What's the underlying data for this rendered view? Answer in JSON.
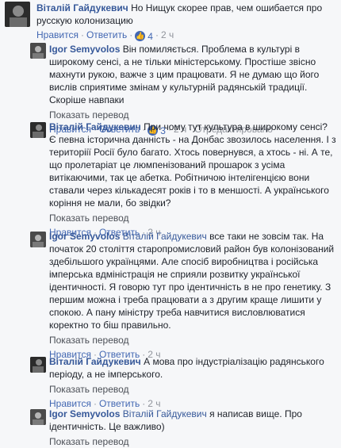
{
  "labels": {
    "like": "Нравится",
    "reply": "Ответить",
    "translate": "Показать перевод",
    "edited": "Отредактировано"
  },
  "comments": [
    {
      "author": "Віталій Гайдукевич",
      "mention": "",
      "text": "Но Нищук скорее прав, чем ошибается про русскую колонизацию",
      "likes": "4",
      "time": "2 ч",
      "edited": ""
    },
    {
      "author": "Igor Semyvolos",
      "mention": "",
      "text": "Він помиляється. Проблема в культурі в широкому сенсі, а не тільки міністерському. Простіше звісно махнути рукою, важче з цим працювати. Я не думаю що його вислів сприятиме змінам у культурній радянській традиції. Скоріше навпаки",
      "likes": "3",
      "time": "2 ч",
      "edited": "Отредактировано"
    },
    {
      "author": "Віталій Гайдукевич",
      "mention": "",
      "text": "При чому тут культура в широкому сенсі? Є певна історична данність - на Донбас звозилось населення. І з територіії Росії було багато. Хтось повернувся, а хтось - ні. А те, що пролетаріат це люмпенізований прошарок з усіма витікаючими, так це абетка. Робітничою інтелігенцією вони ставали через кількадесят років і то в меншості. А українського коріння не мали, бо звідки?",
      "likes": "",
      "time": "2 ч",
      "edited": ""
    },
    {
      "author": "Igor Semyvolos",
      "mention": "Віталій Гайдукевич",
      "text": "все таки не зовсім так. На початок 20 століття старопромисловий район був колонізований здебільшого українцями. Але спосіб виробництва і російська імперська вдміністрація не сприяли розвитку української ідентичності. Я говорю тут про ідентичність в не про генетику. З першим можна і треба працювати а з другим краще лишити у спокою. А пану міністру треба навчитися висловлюватися коректно то біш правильно.",
      "likes": "",
      "time": "2 ч",
      "edited": ""
    },
    {
      "author": "Віталій Гайдукевич",
      "mention": "",
      "text": "А мова про індустріалізацію радянського періоду, а не імперського.",
      "likes": "",
      "time": "2 ч",
      "edited": ""
    },
    {
      "author": "Igor Semyvolos",
      "mention": "Віталій Гайдукевич",
      "text": "я написав вище. Про ідентичність. Це важливо)",
      "likes": "",
      "time": "",
      "edited": ""
    }
  ]
}
